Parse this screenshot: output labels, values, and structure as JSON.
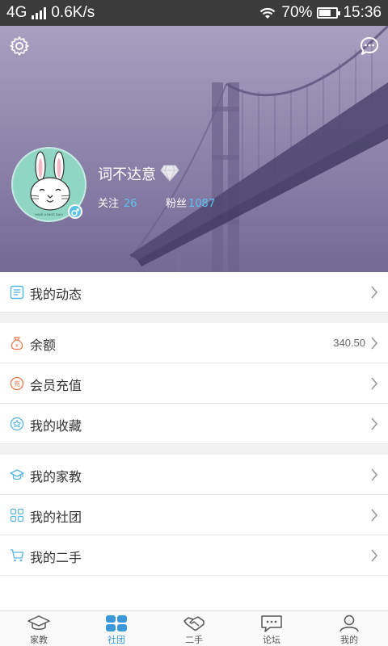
{
  "status_bar": {
    "network": "4G",
    "speed": "0.6K/s",
    "battery": "70%",
    "battery_level": 0.7,
    "time": "15:36"
  },
  "profile": {
    "username": "词不达意",
    "following_label": "关注",
    "following_count": "26",
    "fans_label": "粉丝",
    "fans_count": "1087",
    "avatar_caption": "HAVE A NICE DAY!"
  },
  "menu": {
    "section1": [
      {
        "label": "我的动态",
        "icon": "feed-icon"
      }
    ],
    "section2": [
      {
        "label": "余额",
        "value": "340.50",
        "icon": "money-bag-icon"
      },
      {
        "label": "会员充值",
        "icon": "recharge-icon",
        "icon_text": "充"
      },
      {
        "label": "我的收藏",
        "icon": "star-icon"
      }
    ],
    "section3": [
      {
        "label": "我的家教",
        "icon": "graduation-cap-icon"
      },
      {
        "label": "我的社团",
        "icon": "grid-icon"
      },
      {
        "label": "我的二手",
        "icon": "cart-icon"
      }
    ]
  },
  "tabs": [
    {
      "label": "家教",
      "icon": "graduation-cap-icon"
    },
    {
      "label": "社团",
      "icon": "grid-icon"
    },
    {
      "label": "二手",
      "icon": "handshake-icon"
    },
    {
      "label": "论坛",
      "icon": "chat-icon"
    },
    {
      "label": "我的",
      "icon": "person-icon"
    }
  ],
  "colors": {
    "accent": "#3a98d8",
    "stat_number": "#5cc4f0",
    "header_purple": "#8e84ac",
    "avatar_bg": "#8fd6c4"
  }
}
